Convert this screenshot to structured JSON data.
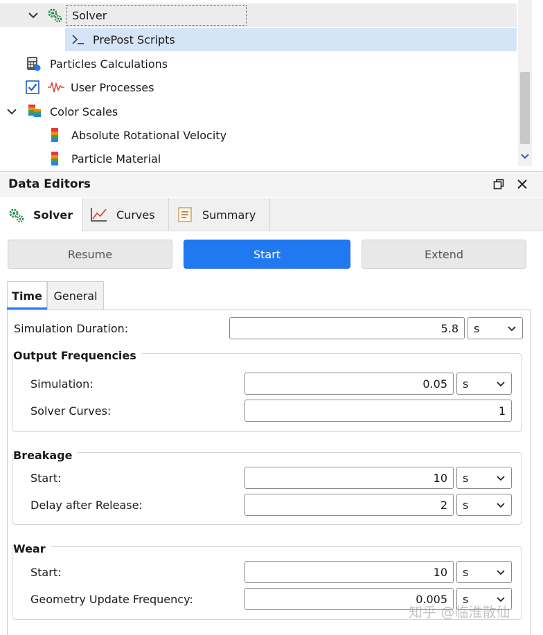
{
  "tree": {
    "items": [
      {
        "label": "Solver",
        "icon": "gears-icon",
        "state": "focused"
      },
      {
        "label": "PrePost Scripts",
        "icon": "script-prompt-icon",
        "state": "selected"
      },
      {
        "label": "Particles Calculations",
        "icon": "calculator-icon"
      },
      {
        "label": "User Processes",
        "icon": "waveform-icon",
        "checked": true
      },
      {
        "label": "Color Scales",
        "icon": "color-scale-icon",
        "expanded": true
      },
      {
        "label": "Absolute Rotational Velocity",
        "icon": "color-scale-icon"
      },
      {
        "label": "Particle Material",
        "icon": "color-scale-icon"
      }
    ]
  },
  "panel": {
    "title": "Data Editors",
    "tabs": [
      {
        "label": "Solver",
        "icon": "gears-icon",
        "active": true
      },
      {
        "label": "Curves",
        "icon": "chart-icon"
      },
      {
        "label": "Summary",
        "icon": "document-icon"
      }
    ]
  },
  "actions": {
    "resume": "Resume",
    "start": "Start",
    "extend": "Extend"
  },
  "subtabs": [
    {
      "label": "Time",
      "active": true
    },
    {
      "label": "General"
    }
  ],
  "form": {
    "simulation_duration": {
      "label": "Simulation Duration:",
      "value": "5.8",
      "unit": "s"
    },
    "output_frequencies": {
      "title": "Output Frequencies",
      "simulation": {
        "label": "Simulation:",
        "value": "0.05",
        "unit": "s"
      },
      "solver_curves": {
        "label": "Solver Curves:",
        "value": "1"
      }
    },
    "breakage": {
      "title": "Breakage",
      "start": {
        "label": "Start:",
        "value": "10",
        "unit": "s"
      },
      "delay": {
        "label": "Delay after Release:",
        "value": "2",
        "unit": "s"
      }
    },
    "wear": {
      "title": "Wear",
      "start": {
        "label": "Start:",
        "value": "10",
        "unit": "s"
      },
      "geometry": {
        "label": "Geometry Update Frequency:",
        "value": "0.005",
        "unit": "s"
      }
    }
  },
  "watermark": "知乎 @临淮散仙",
  "colors": {
    "accent": "#2179f2",
    "selection": "#d6e4f8"
  }
}
